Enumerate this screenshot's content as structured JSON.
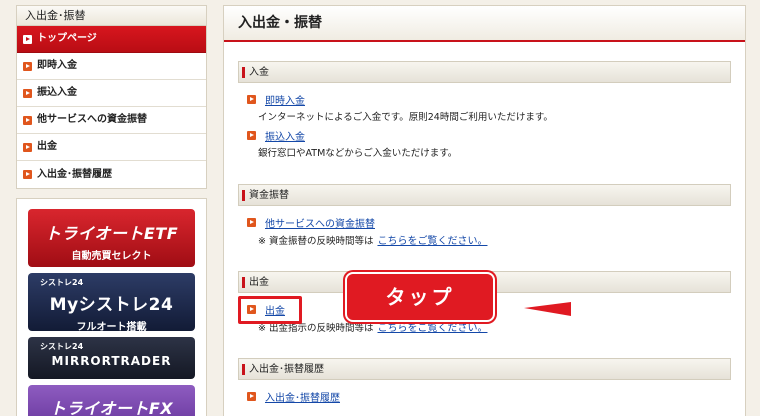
{
  "sidebar": {
    "title": "入出金･振替",
    "items": [
      {
        "label": "トップページ",
        "active": true
      },
      {
        "label": "即時入金"
      },
      {
        "label": "振込入金"
      },
      {
        "label": "他サービスへの資金振替"
      },
      {
        "label": "出金"
      },
      {
        "label": "入出金･振替履歴"
      }
    ]
  },
  "banners": {
    "etf": {
      "main": "トライオートETF",
      "sub": "自動売買セレクト"
    },
    "mysystre": {
      "small": "シストレ24",
      "main": "Myシストレ24",
      "sub": "フルオート搭載"
    },
    "mirror": {
      "small": "シストレ24",
      "main": "MIRRORTRADER"
    },
    "fx": {
      "main": "トライオートFX"
    }
  },
  "main": {
    "title": "入出金・振替",
    "sections": {
      "deposit": {
        "heading": "入金",
        "instant_link": "即時入金",
        "instant_desc": "インターネットによるご入金です。原則24時間ご利用いただけます。",
        "transfer_link": "振込入金",
        "transfer_desc": "銀行窓口やATMなどからご入金いただけます。"
      },
      "funds": {
        "heading": "資金振替",
        "link": "他サービスへの資金振替",
        "note": "※ 資金振替の反映時間等は",
        "note_link": "こちらをご覧ください。"
      },
      "withdraw": {
        "heading": "出金",
        "link": "出金",
        "note": "※ 出金指示の反映時間等は",
        "note_link": "こちらをご覧ください。"
      },
      "history": {
        "heading": "入出金･振替履歴",
        "link": "入出金･振替履歴"
      }
    }
  },
  "annotation": {
    "callout": "タップ"
  },
  "colors": {
    "accent": "#c8121a",
    "link": "#1448a8",
    "arrow": "#e0561d"
  }
}
